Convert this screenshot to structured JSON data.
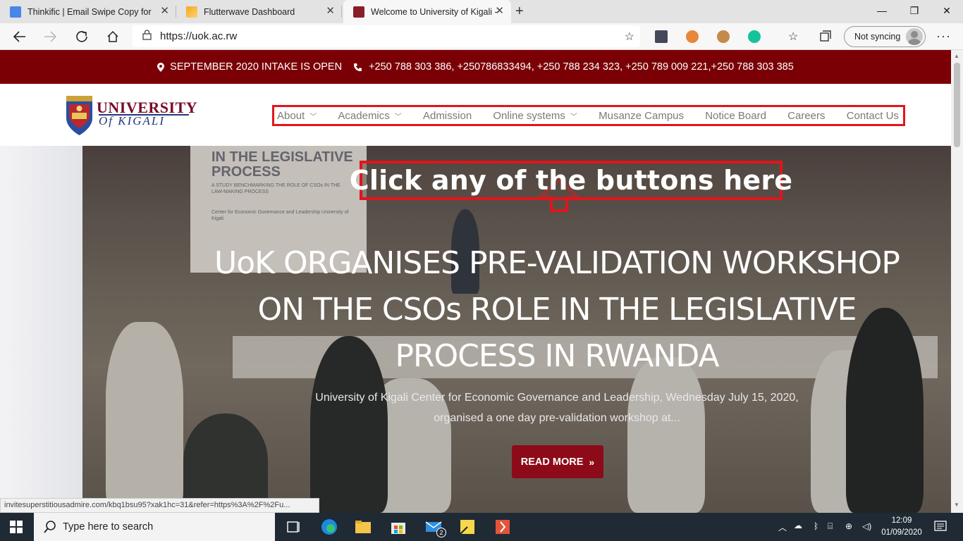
{
  "browser": {
    "tabs": [
      {
        "label": "Thinkific | Email Swipe Copy for F",
        "icon": "google-docs-icon",
        "active": false
      },
      {
        "label": "Flutterwave Dashboard",
        "icon": "flutterwave-icon",
        "active": false
      },
      {
        "label": "Welcome to University of Kigali -",
        "icon": "uok-favicon-icon",
        "active": true
      }
    ],
    "address": "https://uok.ac.rw",
    "sync_label": "Not syncing"
  },
  "site": {
    "top_strip": {
      "intake": "SEPTEMBER 2020 INTAKE IS OPEN",
      "phones": "+250 788 303 386, +250786833494, +250 788 234 323, +250 789 009 221,+250 788 303 385"
    },
    "logo": {
      "line1": "UNIVERSITY",
      "line2": "Of KIGALI"
    },
    "nav": [
      {
        "label": "About",
        "has_dropdown": true
      },
      {
        "label": "Academics",
        "has_dropdown": true
      },
      {
        "label": "Admission",
        "has_dropdown": false
      },
      {
        "label": "Online systems",
        "has_dropdown": true
      },
      {
        "label": "Musanze Campus",
        "has_dropdown": false
      },
      {
        "label": "Notice Board",
        "has_dropdown": false
      },
      {
        "label": "Careers",
        "has_dropdown": false
      },
      {
        "label": "Contact Us",
        "has_dropdown": false
      }
    ],
    "callout": "Click any of the buttons here",
    "hero": {
      "banner_title": "IN THE LEGISLATIVE PROCESS",
      "banner_sub": "A STUDY BENCHMARKING THE ROLE OF CSOs IN THE LAW-MAKING PROCESS",
      "banner_org": "Center for Economic Governance and Leadership University of Kigali",
      "headline": "UoK ORGANISES PRE-VALIDATION WORKSHOP ON THE CSOs ROLE IN THE LEGISLATIVE PROCESS IN RWANDA",
      "subtitle": "University of Kigali Center for Economic Governance and Leadership, Wednesday July 15, 2020, organised a one day pre-validation workshop at...",
      "read_more": "READ MORE"
    },
    "status_url": "invitesuperstitiousadmire.com/kbq1bsu95?xak1hc=31&refer=https%3A%2F%2Fu..."
  },
  "taskbar": {
    "search_placeholder": "Type here to search",
    "mail_badge": "2",
    "time": "12:09",
    "date": "01/09/2020"
  },
  "colors": {
    "brand_maroon": "#7a0006",
    "read_more": "#8d0b18",
    "callout_border": "#e3141b"
  }
}
